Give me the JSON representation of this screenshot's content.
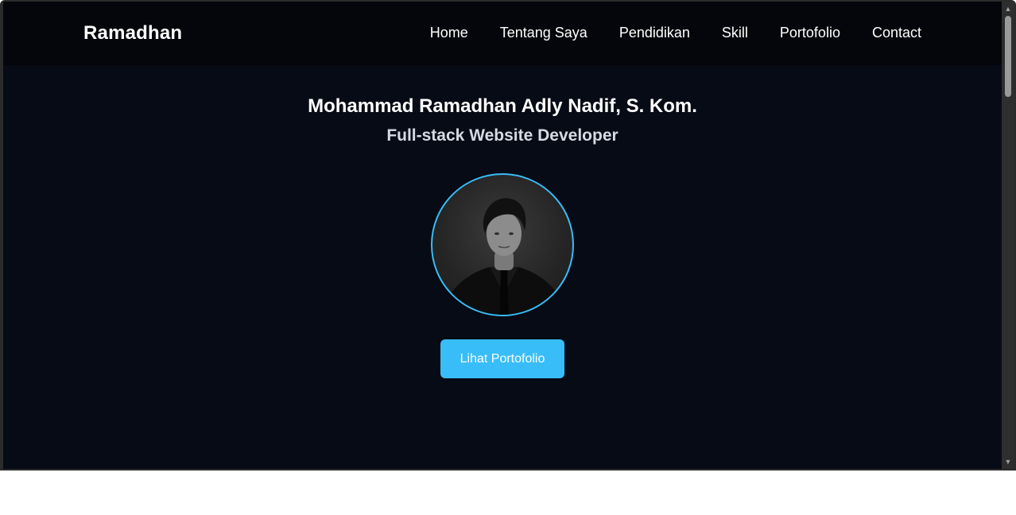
{
  "navbar": {
    "brand": "Ramadhan",
    "links": [
      {
        "label": "Home"
      },
      {
        "label": "Tentang Saya"
      },
      {
        "label": "Pendidikan"
      },
      {
        "label": "Skill"
      },
      {
        "label": "Portofolio"
      },
      {
        "label": "Contact"
      }
    ]
  },
  "hero": {
    "name": "Mohammad Ramadhan Adly Nadif, S. Kom.",
    "role": "Full-stack Website Developer",
    "button_label": "Lihat Portofolio",
    "avatar_icon": "profile-photo"
  },
  "colors": {
    "accent": "#38bdf8",
    "background": "#070b15",
    "navbar": "#04060b"
  },
  "scrollbar": {
    "up_icon": "triangle-up-icon",
    "down_icon": "triangle-down-icon"
  }
}
